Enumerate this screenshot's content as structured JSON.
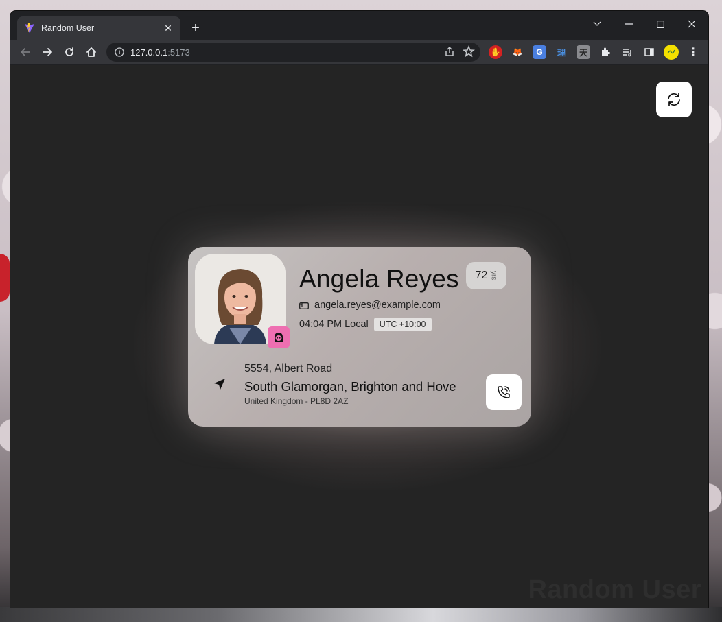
{
  "browser": {
    "tab_title": "Random User",
    "url_host": "127.0.0.1",
    "url_port": ":5173"
  },
  "profile": {
    "name": "Angela Reyes",
    "age": "72",
    "age_unit": "yrs",
    "email": "angela.reyes@example.com",
    "local_time": "04:04 PM Local",
    "utc_offset": "UTC +10:00",
    "gender_icon": "female-face-icon"
  },
  "address": {
    "street": "5554, Albert Road",
    "region": "South Glamorgan, Brighton and Hove",
    "country_postcode": "United Kingdom - PL8D 2AZ"
  },
  "watermark": "Random User",
  "colors": {
    "page_background": "#242424",
    "card_background": "#b8afae",
    "gender_badge": "#ee6fb1",
    "button_background": "#ffffff"
  }
}
